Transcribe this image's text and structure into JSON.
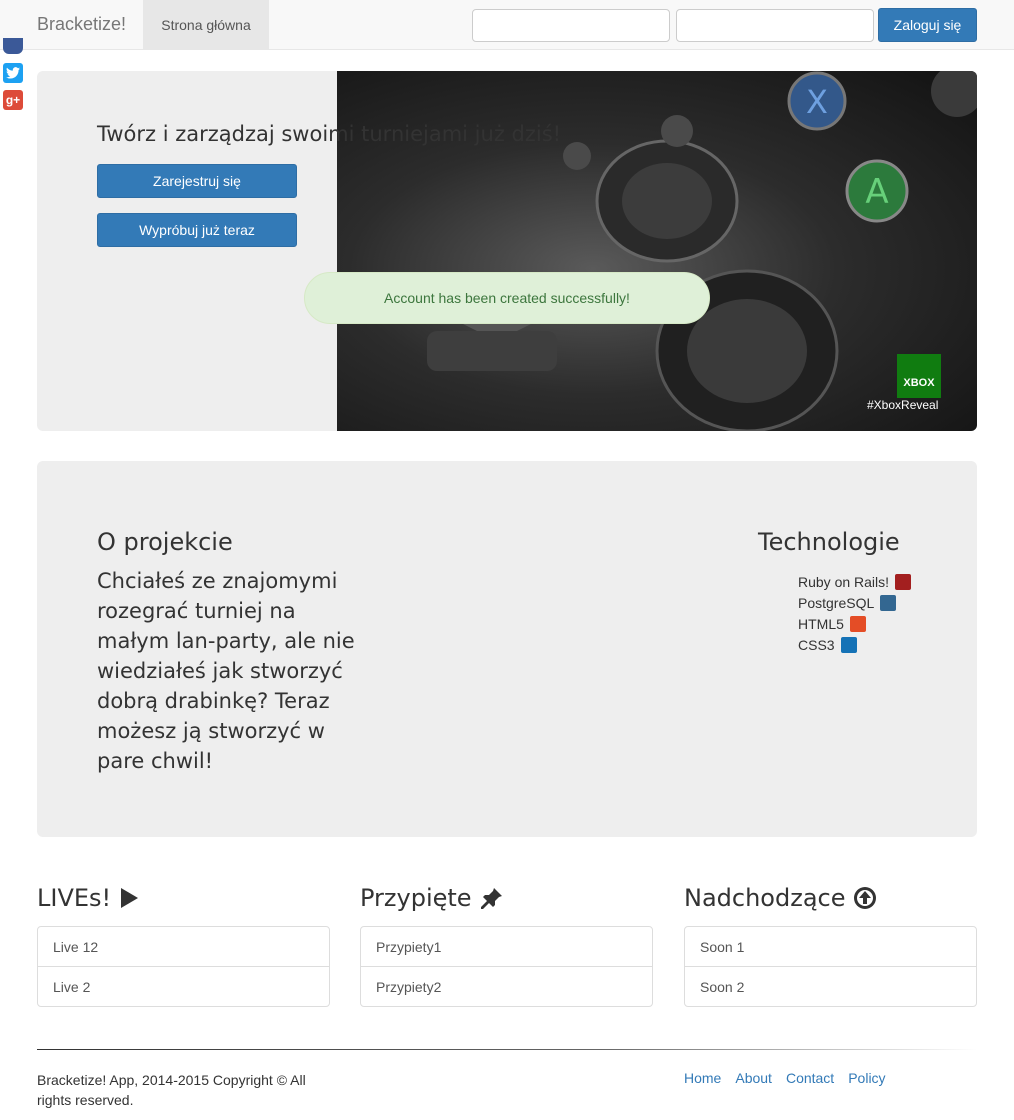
{
  "nav": {
    "brand": "Bracketize!",
    "active_tab": "Strona główna",
    "login_button": "Zaloguj się",
    "email_placeholder": "",
    "password_placeholder": ""
  },
  "social": {
    "twitter": "t",
    "googleplus": "g+"
  },
  "hero": {
    "title": "Twórz i zarządzaj swoimi turniejami już dziś!",
    "register_button": "Zarejestruj się",
    "try_button": "Wypróbuj już teraz",
    "alert": "Account has been created successfully!",
    "image_caption": "#XboxReveal",
    "image_logo": "XBOX"
  },
  "about": {
    "title": "O projekcie",
    "text": "Chciałeś ze znajomymi rozegrać turniej na małym lan-party, ale nie wiedziałeś jak stworzyć dobrą drabinkę? Teraz możesz ją stworzyć w pare chwil!"
  },
  "technologies": {
    "title": "Technologie",
    "items": [
      {
        "label": "Ruby on Rails!",
        "color": "#a31f1f"
      },
      {
        "label": "PostgreSQL",
        "color": "#336791"
      },
      {
        "label": "HTML5",
        "color": "#e44d26"
      },
      {
        "label": "CSS3",
        "color": "#1572b6"
      }
    ]
  },
  "lives": {
    "title": "LIVEs!",
    "items": [
      "Live 12",
      "Live 2"
    ]
  },
  "pinned": {
    "title": "Przypięte",
    "items": [
      "Przypiety1",
      "Przypiety2"
    ]
  },
  "upcoming": {
    "title": "Nadchodzące",
    "items": [
      "Soon 1",
      "Soon 2"
    ]
  },
  "footer": {
    "copyright": "Bracketize! App, 2014-2015 Copyright © All rights reserved.",
    "links": [
      "Home",
      "About",
      "Contact",
      "Policy"
    ]
  },
  "colors": {
    "primary": "#337ab7",
    "success_bg": "#dff0d8",
    "success_text": "#3c763d",
    "panel_bg": "#eeeeee"
  }
}
